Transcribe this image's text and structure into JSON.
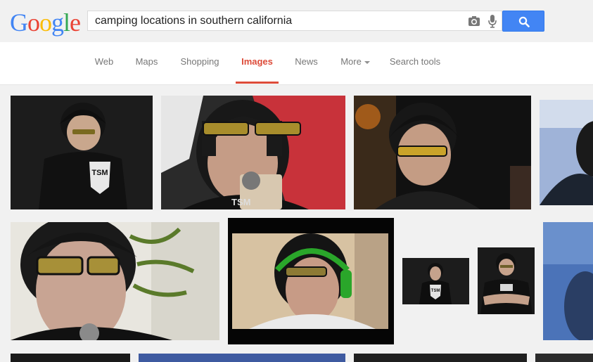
{
  "logo": {
    "letters": [
      "G",
      "o",
      "o",
      "g",
      "l",
      "e"
    ],
    "colors": [
      "#4285f4",
      "#ea4335",
      "#fbbc05",
      "#4285f4",
      "#34a853",
      "#ea4335"
    ]
  },
  "search": {
    "query": "camping locations in southern california",
    "icons": [
      "camera-icon",
      "mic-icon",
      "search-icon"
    ]
  },
  "colors": {
    "accent": "#dd4b39",
    "button": "#4285f4"
  },
  "nav": {
    "tabs": [
      {
        "label": "Web"
      },
      {
        "label": "Maps"
      },
      {
        "label": "Shopping"
      },
      {
        "label": "Images",
        "active": true
      },
      {
        "label": "News"
      },
      {
        "label": "More"
      },
      {
        "label": "Search tools"
      }
    ]
  },
  "results": {
    "tiles": [
      "TSM",
      "TSM",
      "",
      "",
      "",
      "",
      "TSM",
      "",
      "",
      ""
    ]
  }
}
